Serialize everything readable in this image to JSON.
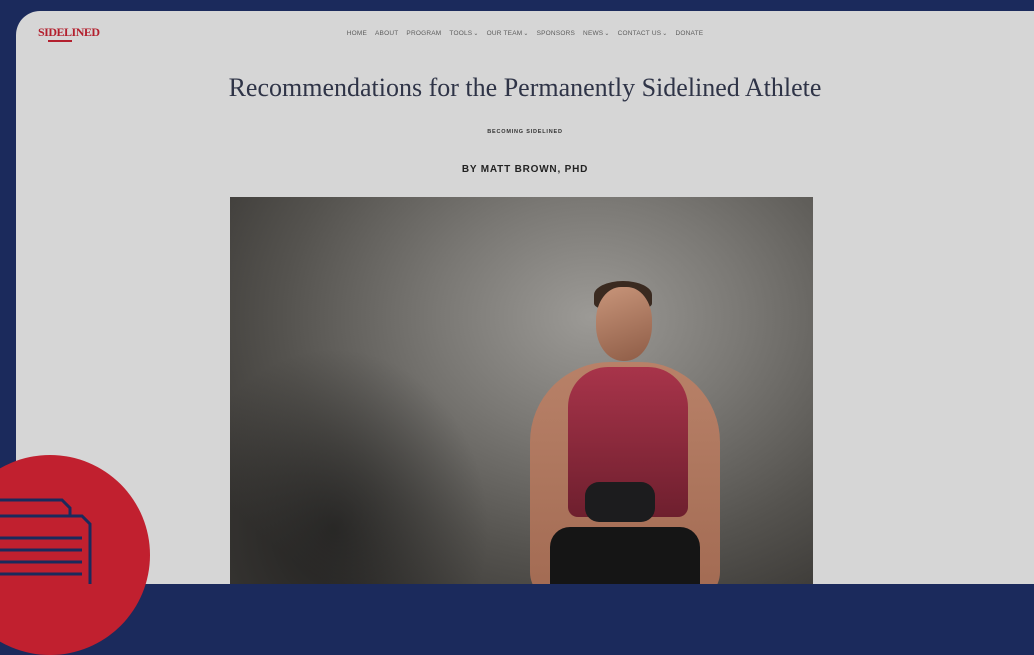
{
  "brand": {
    "logo_text": "SIDELINED"
  },
  "nav": {
    "items": [
      {
        "label": "HOME",
        "dropdown": false
      },
      {
        "label": "ABOUT",
        "dropdown": false
      },
      {
        "label": "PROGRAM",
        "dropdown": false
      },
      {
        "label": "TOOLS",
        "dropdown": true
      },
      {
        "label": "OUR TEAM",
        "dropdown": true
      },
      {
        "label": "SPONSORS",
        "dropdown": false
      },
      {
        "label": "NEWS",
        "dropdown": true
      },
      {
        "label": "CONTACT US",
        "dropdown": true
      },
      {
        "label": "DONATE",
        "dropdown": false
      }
    ]
  },
  "article": {
    "title": "Recommendations for the Permanently Sidelined Athlete",
    "category": "BECOMING SIDELINED",
    "byline": "BY MATT BROWN, PHD"
  },
  "colors": {
    "background": "#1b2a5c",
    "page": "#d6d6d6",
    "accent_red": "#c1202f"
  },
  "icons": {
    "document": "document-stack-icon"
  }
}
